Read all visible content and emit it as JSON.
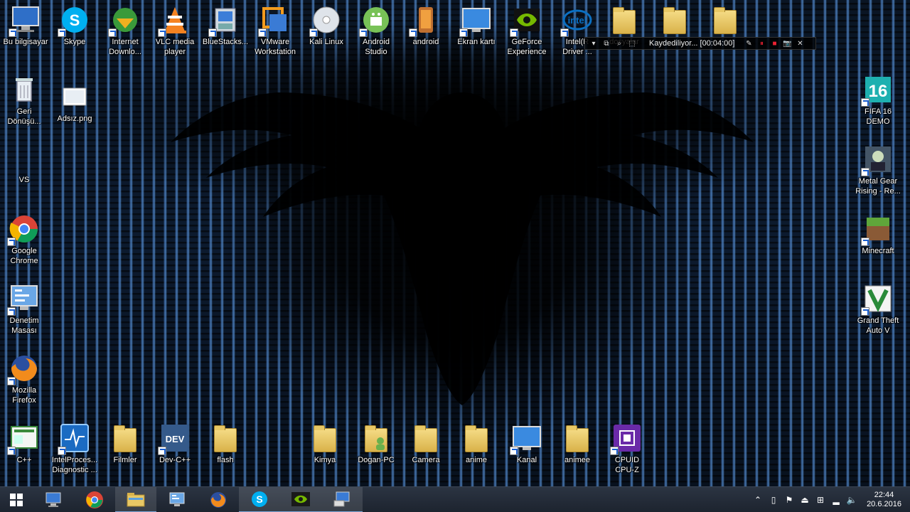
{
  "desktop": {
    "top_row": [
      {
        "label": "Bu bilgisayar",
        "icon": "computer-icon"
      },
      {
        "label": "Skype",
        "icon": "skype-icon"
      },
      {
        "label": "Internet\nDownlo...",
        "icon": "idm-icon"
      },
      {
        "label": "VLC media\nplayer",
        "icon": "vlc-icon"
      },
      {
        "label": "BlueStacks...",
        "icon": "bluestacks-icon"
      },
      {
        "label": "VMware\nWorkstation",
        "icon": "vmware-icon"
      },
      {
        "label": "Kali Linux",
        "icon": "disc-icon"
      },
      {
        "label": "Android\nStudio",
        "icon": "android-studio-icon"
      },
      {
        "label": "android",
        "icon": "android-phone-icon"
      },
      {
        "label": "Ekran kartı",
        "icon": "monitor-icon"
      },
      {
        "label": "GeForce\nExperience",
        "icon": "nvidia-icon"
      },
      {
        "label": "Intel(R\nDriver ...",
        "icon": "intel-icon"
      },
      {
        "label": "dosyalar",
        "icon": "folder-icon"
      },
      {
        "label": "",
        "icon": "folder-icon"
      },
      {
        "label": "",
        "icon": "folder-icon"
      }
    ],
    "left_column": [
      {
        "label": "Geri\nDönüşü...",
        "icon": "recycle-bin-icon"
      },
      {
        "label": "VS",
        "icon": "blank-icon"
      },
      {
        "label": "Google\nChrome",
        "icon": "chrome-icon"
      },
      {
        "label": "Denetim\nMasası",
        "icon": "control-panel-icon"
      },
      {
        "label": "Mozilla\nFirefox",
        "icon": "firefox-icon"
      },
      {
        "label": "C++",
        "icon": "cpp-icon"
      }
    ],
    "second_column": [
      {
        "label": "Adsız.png",
        "icon": "image-file-icon"
      }
    ],
    "right_column": [
      {
        "label": "FIFA 16\nDEMO",
        "icon": "fifa-icon"
      },
      {
        "label": "Metal Gear\nRising - Re...",
        "icon": "game-icon"
      },
      {
        "label": "Minecraft",
        "icon": "minecraft-icon"
      },
      {
        "label": "Grand Theft\nAuto V",
        "icon": "gta-icon"
      }
    ],
    "bottom_row": [
      {
        "label": "IntelProces...\nDiagnostic ...",
        "icon": "intel-diagnostic-icon"
      },
      {
        "label": "Filmler",
        "icon": "folder-icon"
      },
      {
        "label": "Dev-C++",
        "icon": "devcpp-icon"
      },
      {
        "label": "flash",
        "icon": "folder-icon"
      },
      {
        "label": "Kimya",
        "icon": "folder-icon"
      },
      {
        "label": "Dogan-PC",
        "icon": "folder-user-icon"
      },
      {
        "label": "Camera",
        "icon": "folder-icon"
      },
      {
        "label": "anime",
        "icon": "folder-icon"
      },
      {
        "label": "Kanal",
        "icon": "monitor-icon"
      },
      {
        "label": "animee",
        "icon": "folder-icon"
      },
      {
        "label": "CPUID\nCPU-Z",
        "icon": "cpuz-icon"
      }
    ]
  },
  "recorder": {
    "status": "Kaydediliyor... [00:04:00]"
  },
  "taskbar": {
    "apps": [
      "start-icon",
      "computer-icon",
      "chrome-icon",
      "file-explorer-icon",
      "control-panel-icon",
      "firefox-icon",
      "skype-icon",
      "nvidia-icon",
      "network-computer-icon"
    ],
    "clock_time": "22:44",
    "clock_date": "20.6.2016"
  },
  "colors": {
    "taskbar": "#1d242f",
    "accent": "#7aa6d8",
    "folder": "#e8c865"
  }
}
